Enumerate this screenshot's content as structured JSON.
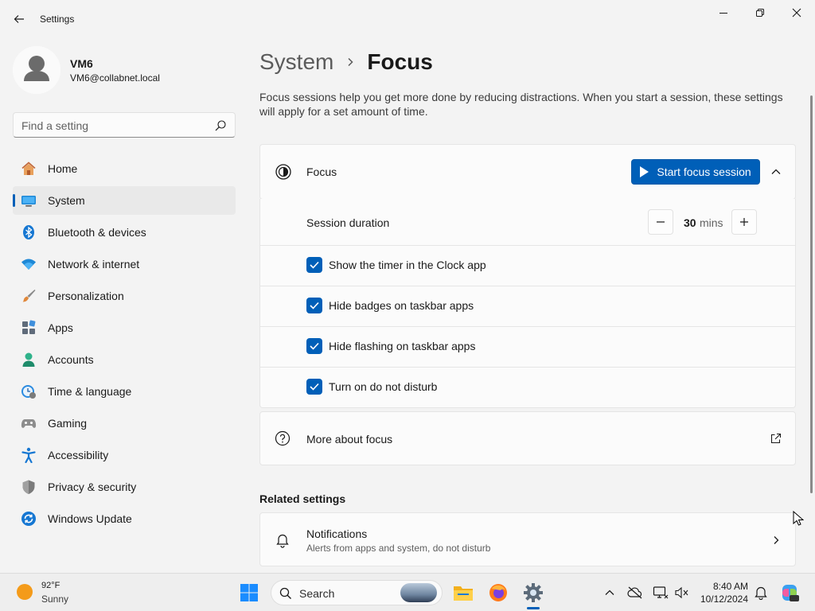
{
  "window": {
    "title": "Settings"
  },
  "user": {
    "name": "VM6",
    "email": "VM6@collabnet.local"
  },
  "search": {
    "placeholder": "Find a setting"
  },
  "nav": {
    "items": [
      {
        "label": "Home",
        "icon": "home-icon"
      },
      {
        "label": "System",
        "icon": "system-icon",
        "active": true
      },
      {
        "label": "Bluetooth & devices",
        "icon": "bluetooth-icon"
      },
      {
        "label": "Network & internet",
        "icon": "wifi-icon"
      },
      {
        "label": "Personalization",
        "icon": "brush-icon"
      },
      {
        "label": "Apps",
        "icon": "apps-icon"
      },
      {
        "label": "Accounts",
        "icon": "accounts-icon"
      },
      {
        "label": "Time & language",
        "icon": "time-language-icon"
      },
      {
        "label": "Gaming",
        "icon": "gamepad-icon"
      },
      {
        "label": "Accessibility",
        "icon": "accessibility-icon"
      },
      {
        "label": "Privacy & security",
        "icon": "shield-icon"
      },
      {
        "label": "Windows Update",
        "icon": "windows-update-icon"
      }
    ]
  },
  "breadcrumb": {
    "parent": "System",
    "current": "Focus"
  },
  "description": "Focus sessions help you get more done by reducing distractions. When you start a session, these settings will apply for a set amount of time.",
  "focus_card": {
    "title": "Focus",
    "start_button": "Start focus session",
    "session_duration_label": "Session duration",
    "duration_value": "30",
    "duration_unit": "mins",
    "options": [
      {
        "label": "Show the timer in the Clock app",
        "checked": true
      },
      {
        "label": "Hide badges on taskbar apps",
        "checked": true
      },
      {
        "label": "Hide flashing on taskbar apps",
        "checked": true
      },
      {
        "label": "Turn on do not disturb",
        "checked": true
      }
    ]
  },
  "more_about": {
    "label": "More about focus"
  },
  "related": {
    "heading": "Related settings",
    "notifications": {
      "title": "Notifications",
      "subtitle": "Alerts from apps and system, do not disturb"
    }
  },
  "taskbar": {
    "weather_temp": "92°F",
    "weather_condition": "Sunny",
    "search_label": "Search",
    "time": "8:40 AM",
    "date": "10/12/2024"
  },
  "colors": {
    "accent": "#005fb8",
    "background": "#f3f3f3",
    "card": "#fbfbfb"
  }
}
